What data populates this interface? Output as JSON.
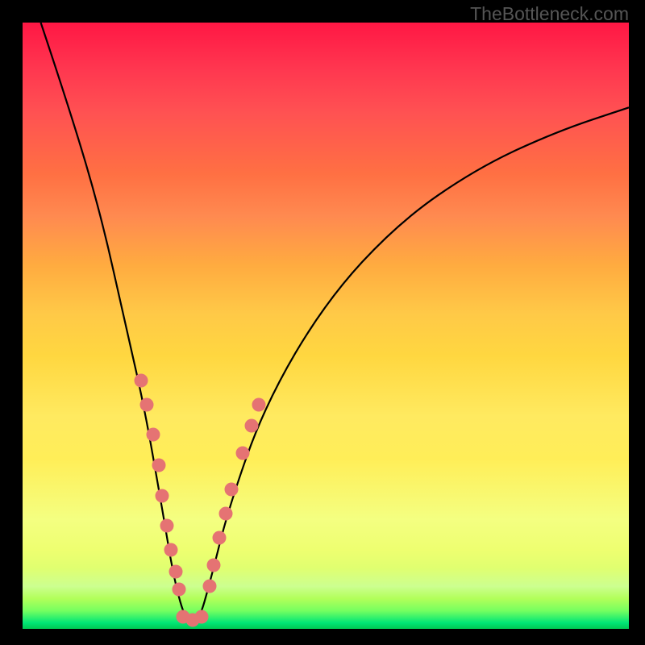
{
  "watermark": "TheBottleneck.com",
  "chart_data": {
    "type": "line",
    "title": "",
    "xlabel": "",
    "ylabel": "",
    "xlim": [
      0,
      100
    ],
    "ylim": [
      0,
      100
    ],
    "curve": {
      "type": "v-curve",
      "minimum_x": 27,
      "points": [
        {
          "x": 3,
          "y": 100
        },
        {
          "x": 8,
          "y": 85
        },
        {
          "x": 13,
          "y": 68
        },
        {
          "x": 17,
          "y": 50
        },
        {
          "x": 20,
          "y": 37
        },
        {
          "x": 23,
          "y": 20
        },
        {
          "x": 25,
          "y": 8
        },
        {
          "x": 27,
          "y": 1
        },
        {
          "x": 29,
          "y": 1
        },
        {
          "x": 31,
          "y": 8
        },
        {
          "x": 34,
          "y": 20
        },
        {
          "x": 40,
          "y": 37
        },
        {
          "x": 50,
          "y": 54
        },
        {
          "x": 62,
          "y": 67
        },
        {
          "x": 75,
          "y": 76
        },
        {
          "x": 88,
          "y": 82
        },
        {
          "x": 100,
          "y": 86
        }
      ]
    },
    "dots_left": [
      {
        "x": 19.5,
        "y": 41
      },
      {
        "x": 20.5,
        "y": 37
      },
      {
        "x": 21.5,
        "y": 32
      },
      {
        "x": 22.5,
        "y": 27
      },
      {
        "x": 23,
        "y": 22
      },
      {
        "x": 23.8,
        "y": 17
      },
      {
        "x": 24.5,
        "y": 13
      },
      {
        "x": 25.2,
        "y": 9.5
      },
      {
        "x": 25.8,
        "y": 6.5
      }
    ],
    "dots_bottom": [
      {
        "x": 26.5,
        "y": 2
      },
      {
        "x": 28,
        "y": 1.5
      },
      {
        "x": 29.5,
        "y": 2
      }
    ],
    "dots_right": [
      {
        "x": 30.8,
        "y": 7
      },
      {
        "x": 31.5,
        "y": 10.5
      },
      {
        "x": 32.5,
        "y": 15
      },
      {
        "x": 33.5,
        "y": 19
      },
      {
        "x": 34.5,
        "y": 23
      },
      {
        "x": 36.3,
        "y": 29
      },
      {
        "x": 37.8,
        "y": 33.5
      },
      {
        "x": 39,
        "y": 37
      }
    ]
  }
}
